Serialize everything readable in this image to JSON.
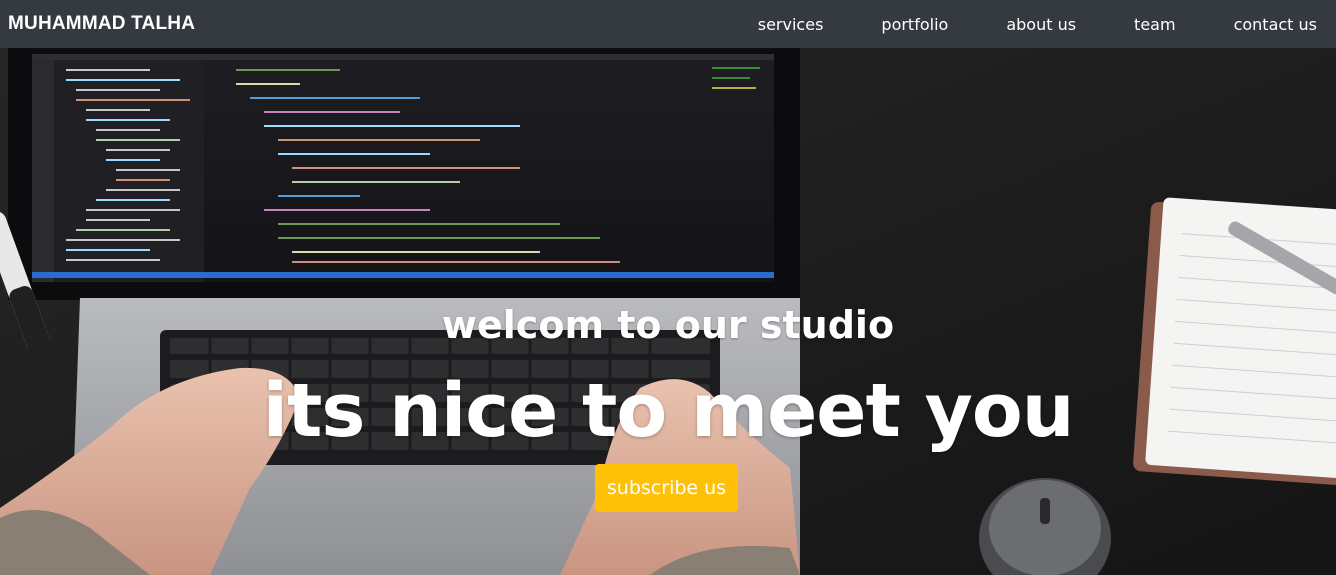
{
  "navbar": {
    "brand": "MUHAMMAD TALHA",
    "links": [
      "services",
      "portfolio",
      "about us",
      "team",
      "contact us"
    ]
  },
  "hero": {
    "subheading": "welcom to our studio",
    "heading": "its nice to meet you",
    "cta_label": "subscribe us",
    "cta_color": "#ffc107"
  },
  "colors": {
    "navbar_bg": "#343a40",
    "text": "#ffffff"
  }
}
